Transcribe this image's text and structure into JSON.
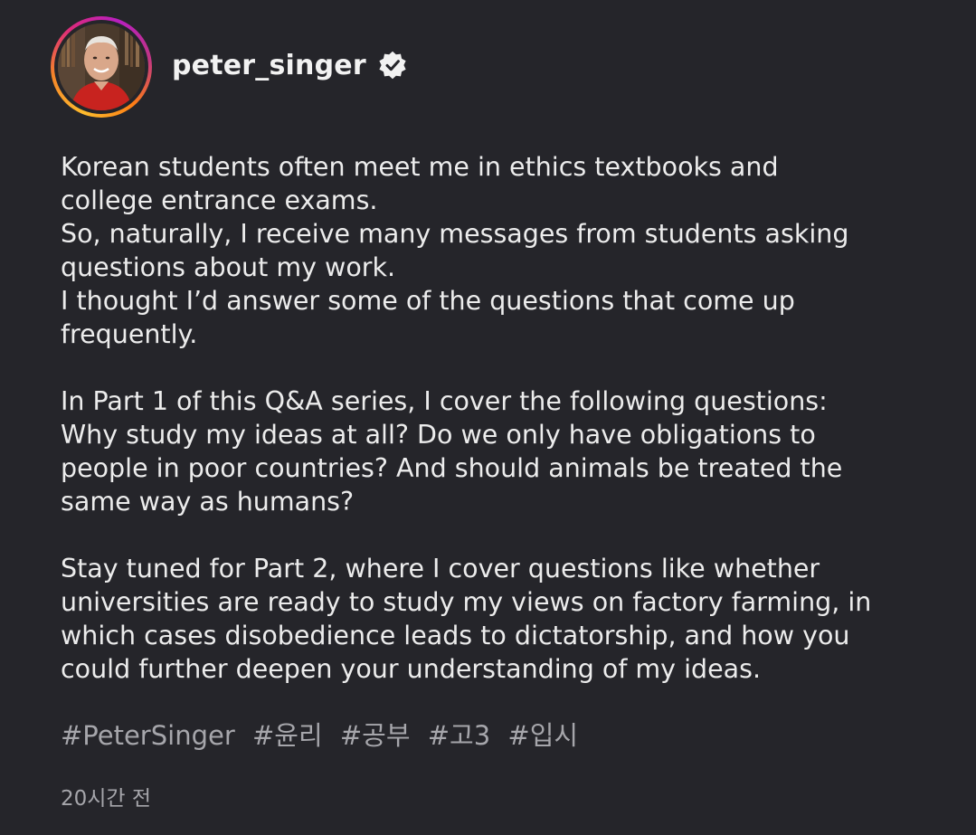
{
  "profile": {
    "username": "peter_singer",
    "verified": true,
    "avatar_icon": "profile-photo",
    "story_ring_colors": [
      "#fdbb2d",
      "#f58529",
      "#dd2a7b",
      "#b81fc0"
    ]
  },
  "post": {
    "paragraphs": [
      {
        "lines": [
          "Korean students often meet me in ethics textbooks and",
          "college entrance exams.",
          "So, naturally, I receive many messages from students asking",
          "questions about my work.",
          "I thought I’d answer some of the questions that come up",
          "frequently."
        ]
      },
      {
        "lines": [
          "In Part 1 of this Q&A series, I cover the following questions:",
          "Why study my ideas at all? Do we only have obligations to",
          "people in poor countries? And should animals be treated the",
          "same way as humans?"
        ]
      },
      {
        "lines": [
          "Stay tuned for Part 2, where I cover questions like whether",
          "universities are ready to study my views on factory farming, in",
          "which cases disobedience leads to dictatorship, and how you",
          "could further deepen your understanding of my ideas."
        ]
      }
    ],
    "hashtags": [
      "#PeterSinger",
      "#윤리",
      "#공부",
      "#고3",
      "#입시"
    ],
    "timestamp": "20시간 전"
  },
  "colors": {
    "background": "#25252a",
    "text": "#ececec",
    "muted": "#a6a6ab"
  }
}
